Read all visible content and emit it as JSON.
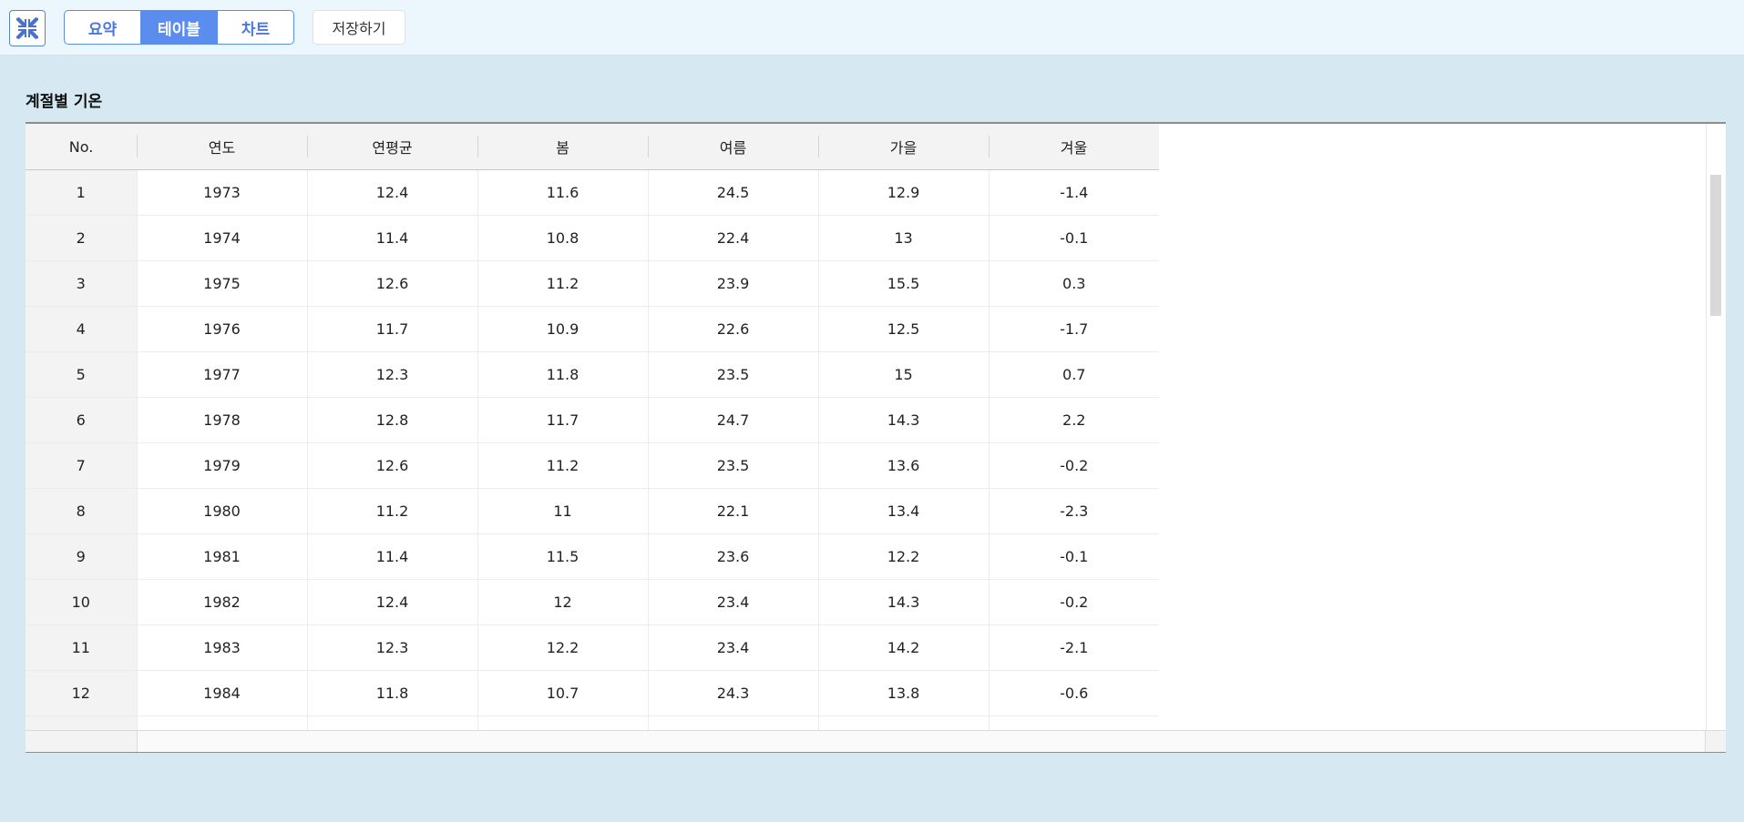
{
  "toolbar": {
    "collapse_icon": "collapse-arrows-icon",
    "tabs": [
      {
        "label": "요약",
        "active": false
      },
      {
        "label": "테이블",
        "active": true
      },
      {
        "label": "차트",
        "active": false
      }
    ],
    "save_label": "저장하기"
  },
  "section": {
    "title": "계절별 기온"
  },
  "table": {
    "columns": [
      "No.",
      "연도",
      "연평균",
      "봄",
      "여름",
      "가을",
      "겨울"
    ],
    "rows": [
      [
        "1",
        "1973",
        "12.4",
        "11.6",
        "24.5",
        "12.9",
        "-1.4"
      ],
      [
        "2",
        "1974",
        "11.4",
        "10.8",
        "22.4",
        "13",
        "-0.1"
      ],
      [
        "3",
        "1975",
        "12.6",
        "11.2",
        "23.9",
        "15.5",
        "0.3"
      ],
      [
        "4",
        "1976",
        "11.7",
        "10.9",
        "22.6",
        "12.5",
        "-1.7"
      ],
      [
        "5",
        "1977",
        "12.3",
        "11.8",
        "23.5",
        "15",
        "0.7"
      ],
      [
        "6",
        "1978",
        "12.8",
        "11.7",
        "24.7",
        "14.3",
        "2.2"
      ],
      [
        "7",
        "1979",
        "12.6",
        "11.2",
        "23.5",
        "13.6",
        "-0.2"
      ],
      [
        "8",
        "1980",
        "11.2",
        "11",
        "22.1",
        "13.4",
        "-2.3"
      ],
      [
        "9",
        "1981",
        "11.4",
        "11.5",
        "23.6",
        "12.2",
        "-0.1"
      ],
      [
        "10",
        "1982",
        "12.4",
        "12",
        "23.4",
        "14.3",
        "-0.2"
      ],
      [
        "11",
        "1983",
        "12.3",
        "12.2",
        "23.4",
        "14.2",
        "-2.1"
      ],
      [
        "12",
        "1984",
        "11.8",
        "10.7",
        "24.3",
        "13.8",
        "-0.6"
      ]
    ]
  },
  "colors": {
    "accent": "#5b8def",
    "topbar_bg": "#ebf6fd",
    "page_bg": "#d6e9f3"
  }
}
